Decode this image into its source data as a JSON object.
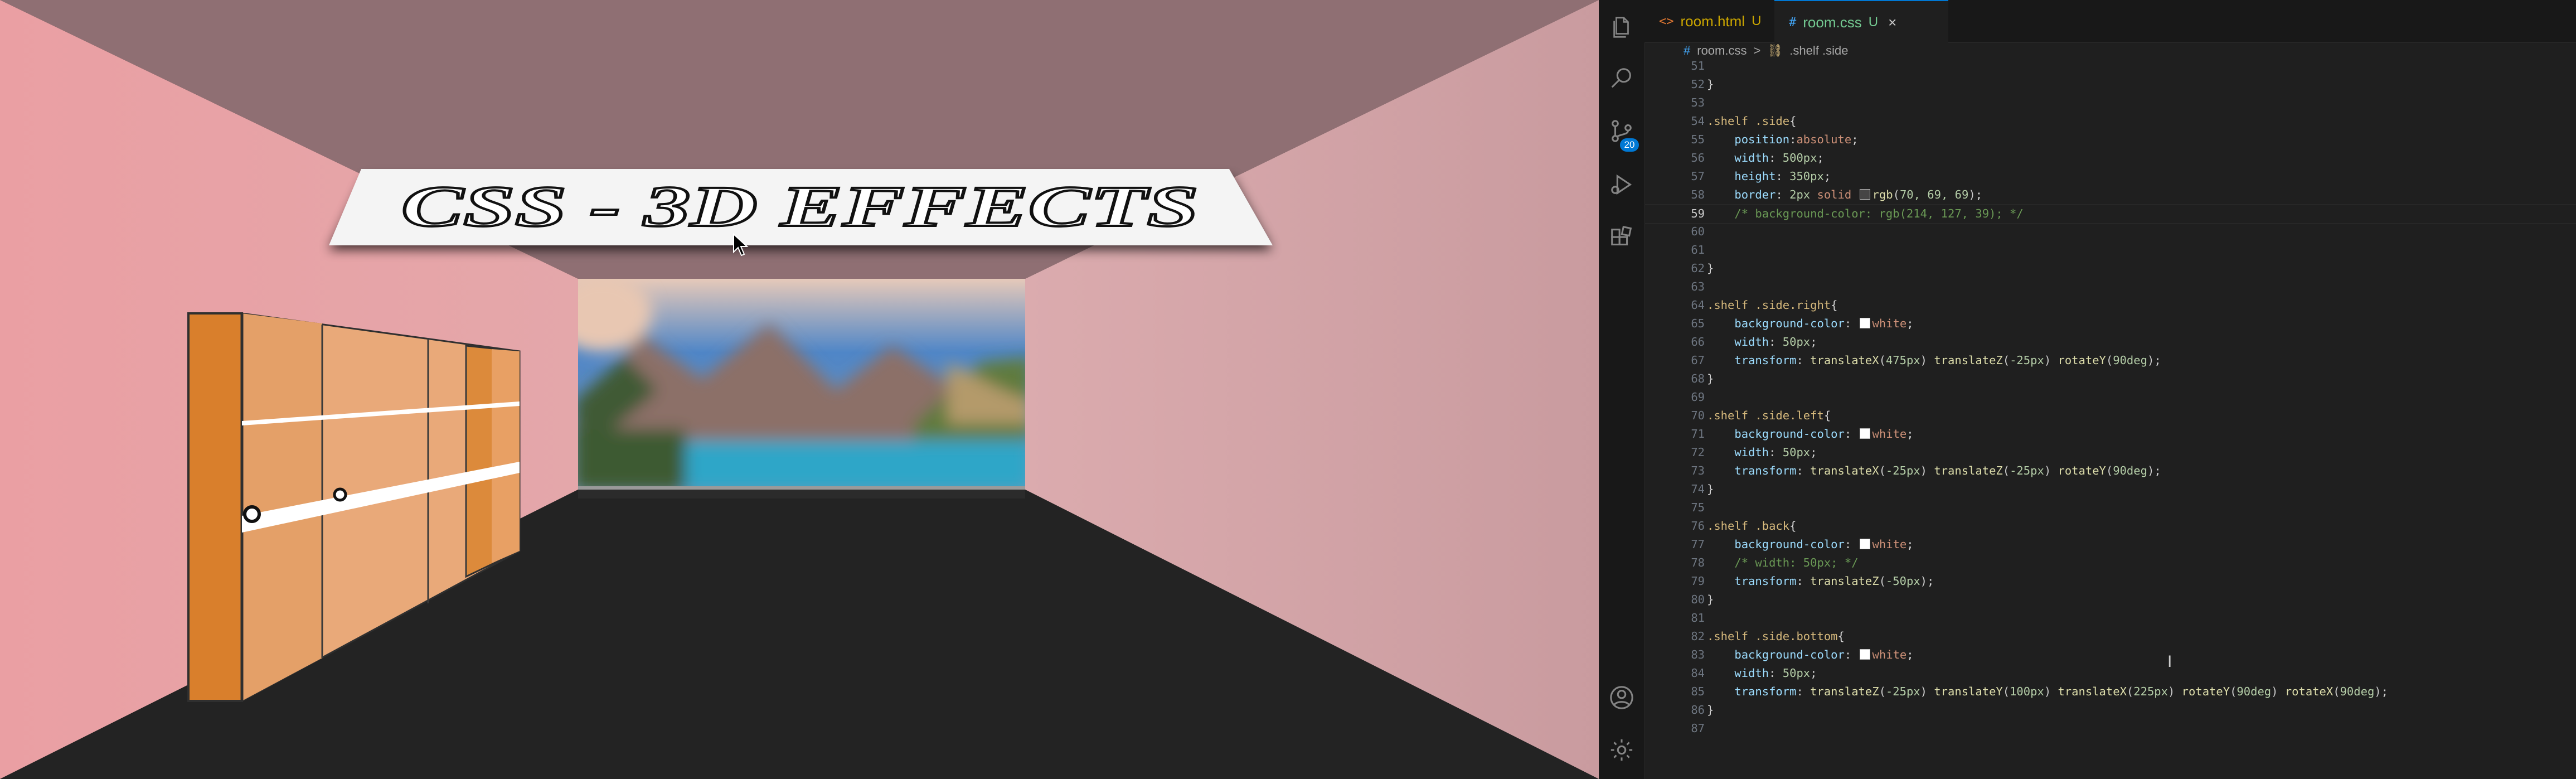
{
  "room": {
    "banner_title": "CSS - 3D EFFECTS",
    "colors": {
      "ceiling": "#8e6f73",
      "left_wall": "#e9a4a6",
      "right_wall": "#d4a4a6",
      "floor": "#222222",
      "shelf_orange": "#d97f2c",
      "shelf_light": "#e9a877"
    }
  },
  "editor": {
    "activity_bar": {
      "icons": [
        "explorer-icon",
        "search-icon",
        "source-control-icon",
        "run-debug-icon",
        "extensions-icon",
        "account-icon",
        "settings-gear-icon"
      ],
      "source_control_badge": "20"
    },
    "tabs": [
      {
        "label": "room.html",
        "status": "U",
        "icon": "<>",
        "active": false
      },
      {
        "label": "room.css",
        "status": "U",
        "icon": "#",
        "active": true,
        "close": "×"
      }
    ],
    "breadcrumb": {
      "file": "room.css",
      "separator": ">",
      "symbol": ".shelf .side"
    },
    "current_line": 59,
    "lines": [
      {
        "n": "51",
        "t": ""
      },
      {
        "n": "52",
        "t": "}"
      },
      {
        "n": "53",
        "t": ""
      },
      {
        "n": "54",
        "t": ".shelf .side{"
      },
      {
        "n": "55",
        "t": "    position:absolute;"
      },
      {
        "n": "56",
        "t": "    width: 500px;"
      },
      {
        "n": "57",
        "t": "    height: 350px;"
      },
      {
        "n": "58",
        "t": "    border: 2px solid rgb(70, 69, 69);"
      },
      {
        "n": "59",
        "t": "    /* background-color: rgb(214, 127, 39); */"
      },
      {
        "n": "60",
        "t": ""
      },
      {
        "n": "61",
        "t": ""
      },
      {
        "n": "62",
        "t": "}"
      },
      {
        "n": "63",
        "t": ""
      },
      {
        "n": "64",
        "t": ".shelf .side.right{"
      },
      {
        "n": "65",
        "t": "    background-color: white;"
      },
      {
        "n": "66",
        "t": "    width: 50px;"
      },
      {
        "n": "67",
        "t": "    transform: translateX(475px) translateZ(-25px) rotateY(90deg);"
      },
      {
        "n": "68",
        "t": "}"
      },
      {
        "n": "69",
        "t": ""
      },
      {
        "n": "70",
        "t": ".shelf .side.left{"
      },
      {
        "n": "71",
        "t": "    background-color: white;"
      },
      {
        "n": "72",
        "t": "    width: 50px;"
      },
      {
        "n": "73",
        "t": "    transform: translateX(-25px) translateZ(-25px) rotateY(90deg);"
      },
      {
        "n": "74",
        "t": "}"
      },
      {
        "n": "75",
        "t": ""
      },
      {
        "n": "76",
        "t": ".shelf .back{"
      },
      {
        "n": "77",
        "t": "    background-color: white;"
      },
      {
        "n": "78",
        "t": "    /* width: 50px; */"
      },
      {
        "n": "79",
        "t": "    transform: translateZ(-50px);"
      },
      {
        "n": "80",
        "t": "}"
      },
      {
        "n": "81",
        "t": ""
      },
      {
        "n": "82",
        "t": ".shelf .side.bottom{"
      },
      {
        "n": "83",
        "t": "    background-color: white;"
      },
      {
        "n": "84",
        "t": "    width: 50px;"
      },
      {
        "n": "85",
        "t": "    transform: translateZ(-25px) translateY(100px) translateX(225px) rotateY(90deg) rotateX(90deg);"
      },
      {
        "n": "86",
        "t": "}"
      },
      {
        "n": "87",
        "t": ""
      }
    ]
  }
}
